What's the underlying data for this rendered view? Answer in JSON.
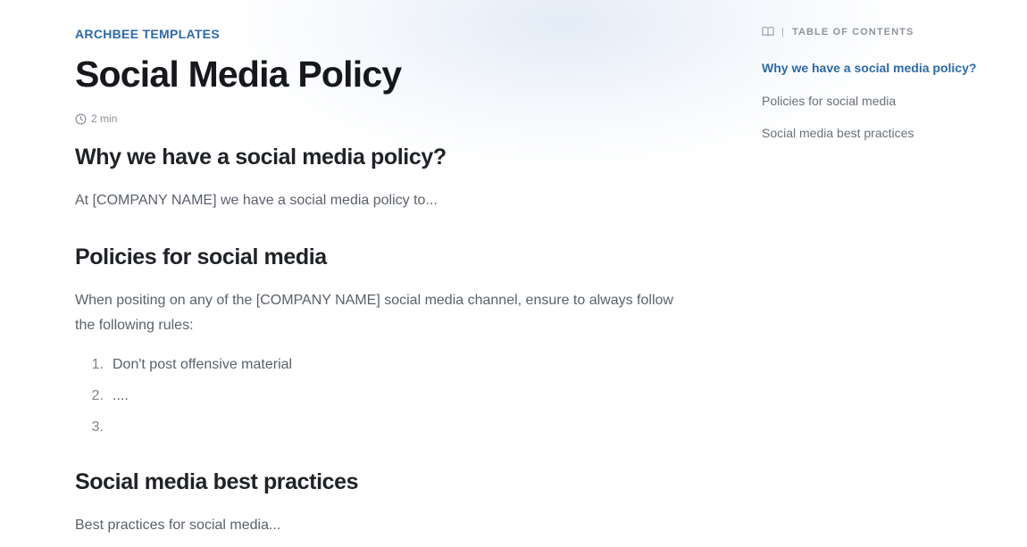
{
  "article": {
    "eyebrow": "ARCHBEE TEMPLATES",
    "title": "Social Media Policy",
    "read_time": "2 min",
    "sections": [
      {
        "heading": "Why we have a social media policy?",
        "body": "At [COMPANY NAME] we have a social media policy to..."
      },
      {
        "heading": "Policies for social media",
        "body": "When positing on any of the [COMPANY NAME] social media channel, ensure to always follow the following rules:",
        "list": [
          {
            "num": "1.",
            "text": "Don't post offensive material"
          },
          {
            "num": "2.",
            "text": "...."
          },
          {
            "num": "3.",
            "text": ""
          }
        ]
      },
      {
        "heading": "Social media best practices",
        "body": "Best practices for social media..."
      }
    ]
  },
  "toc": {
    "icon": "book-icon",
    "separator": "|",
    "heading": "TABLE OF CONTENTS",
    "items": [
      {
        "label": "Why we have a social media policy?",
        "active": true
      },
      {
        "label": "Policies for social media",
        "active": false
      },
      {
        "label": "Social media best practices",
        "active": false
      }
    ]
  },
  "colors": {
    "accent": "#2c6aa8",
    "heading": "#16181c",
    "body": "#5b616b",
    "muted": "#8a8f98"
  },
  "icons": {
    "read_time": "clock-icon"
  }
}
